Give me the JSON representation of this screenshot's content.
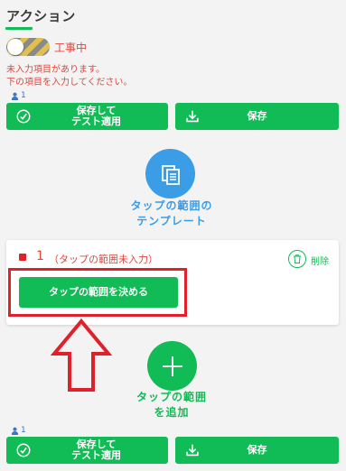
{
  "header": {
    "title": "アクション"
  },
  "toggle": {
    "label": "工事中"
  },
  "warning": {
    "line1": "未入力項目があります。",
    "line2": "下の項目を入力してください。"
  },
  "top_actions": {
    "user_count": "1",
    "save_test_label": "保存して\nテスト適用",
    "save_label": "保存"
  },
  "template": {
    "label_line1": "タップの範囲の",
    "label_line2": "テンプレート"
  },
  "card": {
    "number": "1",
    "status": "（タップの範囲未入力）",
    "delete_label": "削除",
    "decide_label": "タップの範囲を決める"
  },
  "add": {
    "label_line1": "タップの範囲",
    "label_line2": "を追加"
  },
  "bottom_actions": {
    "user_count": "1",
    "save_test_label": "保存して\nテスト適用",
    "save_label": "保存"
  },
  "colors": {
    "green": "#11bb55",
    "blue": "#3a9de6",
    "red": "#e0202a"
  }
}
